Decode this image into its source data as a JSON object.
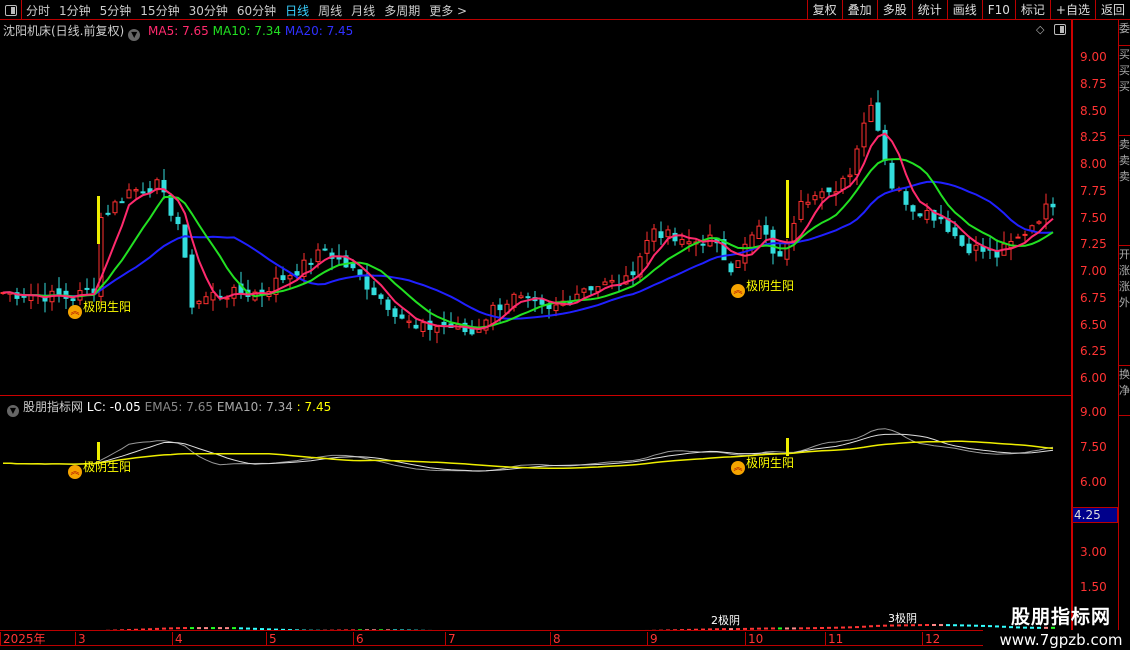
{
  "toolbar": {
    "periods": [
      "分时",
      "1分钟",
      "5分钟",
      "15分钟",
      "30分钟",
      "60分钟",
      "日线",
      "周线",
      "月线",
      "多周期",
      "更多 >"
    ],
    "active": "日线",
    "tools": [
      "复权",
      "叠加",
      "多股",
      "统计",
      "画线",
      "F10",
      "标记",
      "+自选",
      "返回"
    ]
  },
  "main": {
    "stock": "沈阳机床(日线.前复权)",
    "ma5": "MA5: 7.65",
    "ma10": "MA10: 7.34",
    "ma20": "MA20: 7.45",
    "yticks": [
      "9.00",
      "8.75",
      "8.50",
      "8.25",
      "8.00",
      "7.75",
      "7.50",
      "7.25",
      "7.00",
      "6.75",
      "6.50",
      "6.25",
      "6.00"
    ],
    "signal": "极阴生阳"
  },
  "indicator": {
    "name": "股朋指标网",
    "lc": "LC: -0.05",
    "ema5": "EMA5: 7.65",
    "ema10": "EMA10: 7.34",
    "last": ": 7.45",
    "yticks": [
      "9.00",
      "7.50",
      "6.00",
      "3.00",
      "1.50"
    ],
    "cursor": "4.25",
    "signal": "极阴生阳",
    "label2": "2极阴",
    "label3": "3极阴"
  },
  "timeaxis": [
    "2025年",
    "3",
    "4",
    "5",
    "6",
    "7",
    "8",
    "9",
    "10",
    "11",
    "12"
  ],
  "watermark": {
    "name": "股朋指标网",
    "url": "www.7gpzb.com"
  },
  "colors": {
    "ma5": "#ff2a6d",
    "ma10": "#22e022",
    "ma20": "#2020ff",
    "up": "#ff3030",
    "down": "#33dddd",
    "axis": "#ff3333"
  },
  "price_anchors": [
    [
      0,
      6.8
    ],
    [
      10,
      6.75
    ],
    [
      13,
      6.85
    ],
    [
      14,
      7.5
    ],
    [
      18,
      7.75
    ],
    [
      22,
      7.8
    ],
    [
      25,
      7.45
    ],
    [
      27,
      6.7
    ],
    [
      30,
      6.78
    ],
    [
      37,
      6.8
    ],
    [
      39,
      6.9
    ],
    [
      43,
      7.05
    ],
    [
      46,
      7.2
    ],
    [
      50,
      7.0
    ],
    [
      54,
      6.75
    ],
    [
      59,
      6.45
    ],
    [
      63,
      6.5
    ],
    [
      67,
      6.42
    ],
    [
      70,
      6.65
    ],
    [
      73,
      6.75
    ],
    [
      78,
      6.62
    ],
    [
      83,
      6.85
    ],
    [
      89,
      6.9
    ],
    [
      93,
      7.4
    ],
    [
      97,
      7.25
    ],
    [
      101,
      7.3
    ],
    [
      104,
      7.05
    ],
    [
      108,
      7.4
    ],
    [
      111,
      7.1
    ],
    [
      114,
      7.7
    ],
    [
      118,
      7.7
    ],
    [
      121,
      7.95
    ],
    [
      124,
      8.6
    ],
    [
      127,
      7.8
    ],
    [
      130,
      7.6
    ],
    [
      134,
      7.5
    ],
    [
      137,
      7.25
    ],
    [
      142,
      7.15
    ],
    [
      145,
      7.3
    ],
    [
      150,
      7.65
    ]
  ]
}
